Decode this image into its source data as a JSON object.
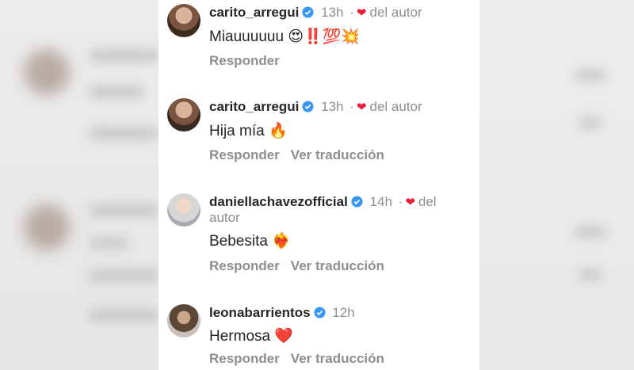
{
  "comments": [
    {
      "username": "carito_arregui",
      "time": "13h",
      "author_like_label": "del autor",
      "text": "Miauuuuuu 😍‼️💯💥",
      "reply_label": "Responder",
      "translate_label": ""
    },
    {
      "username": "carito_arregui",
      "time": "13h",
      "author_like_label": "del autor",
      "text": "Hija mía 🔥",
      "reply_label": "Responder",
      "translate_label": "Ver traducción"
    },
    {
      "username": "daniellachavezofficial",
      "time": "14h",
      "author_like_label_line1": "del",
      "author_like_label_line2": "autor",
      "text": "Bebesita ❤️‍🔥",
      "reply_label": "Responder",
      "translate_label": "Ver traducción"
    },
    {
      "username": "leonabarrientos",
      "time": "12h",
      "text": "Hermosa ❤️",
      "reply_label": "Responder",
      "translate_label": "Ver traducción"
    }
  ],
  "colors": {
    "heart": "#ed1b3a",
    "verified": "#3897f0",
    "muted": "#8e8e8e",
    "text": "#262626"
  }
}
